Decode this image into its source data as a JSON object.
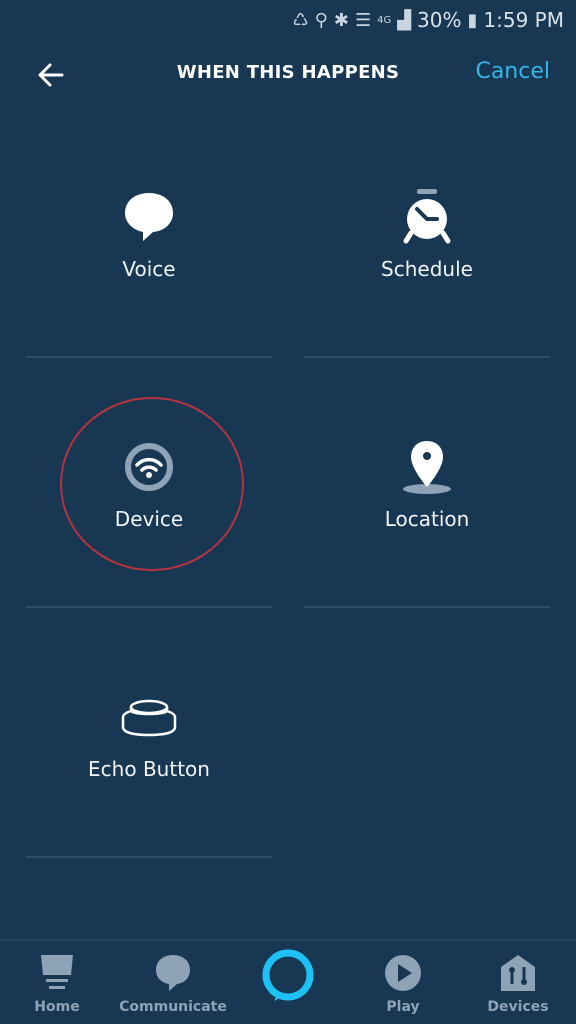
{
  "status_bar": {
    "battery": "30%",
    "time": "1:59 PM",
    "network": "4G",
    "icons": [
      "data-saver-icon",
      "location-icon",
      "bluetooth-icon",
      "wifi-icon",
      "lte-icon",
      "signal-icon",
      "battery-icon"
    ]
  },
  "header": {
    "back_icon": "arrow-left-icon",
    "title": "WHEN THIS HAPPENS",
    "cancel_label": "Cancel"
  },
  "triggers": [
    {
      "label": "Voice",
      "icon": "speech-bubble-icon"
    },
    {
      "label": "Schedule",
      "icon": "alarm-clock-icon"
    },
    {
      "label": "Device",
      "icon": "wifi-device-icon",
      "highlighted": true
    },
    {
      "label": "Location",
      "icon": "map-pin-icon"
    },
    {
      "label": "Echo Button",
      "icon": "echo-button-icon"
    }
  ],
  "bottom_nav": [
    {
      "label": "Home",
      "icon": "home-icon"
    },
    {
      "label": "Communicate",
      "icon": "communicate-icon"
    },
    {
      "label": "",
      "icon": "alexa-ring-icon"
    },
    {
      "label": "Play",
      "icon": "play-icon"
    },
    {
      "label": "Devices",
      "icon": "devices-icon"
    }
  ],
  "colors": {
    "background": "#173753",
    "accent": "#35b6e8",
    "highlight": "#b8333f",
    "nav_inactive": "#8ea3b6"
  }
}
